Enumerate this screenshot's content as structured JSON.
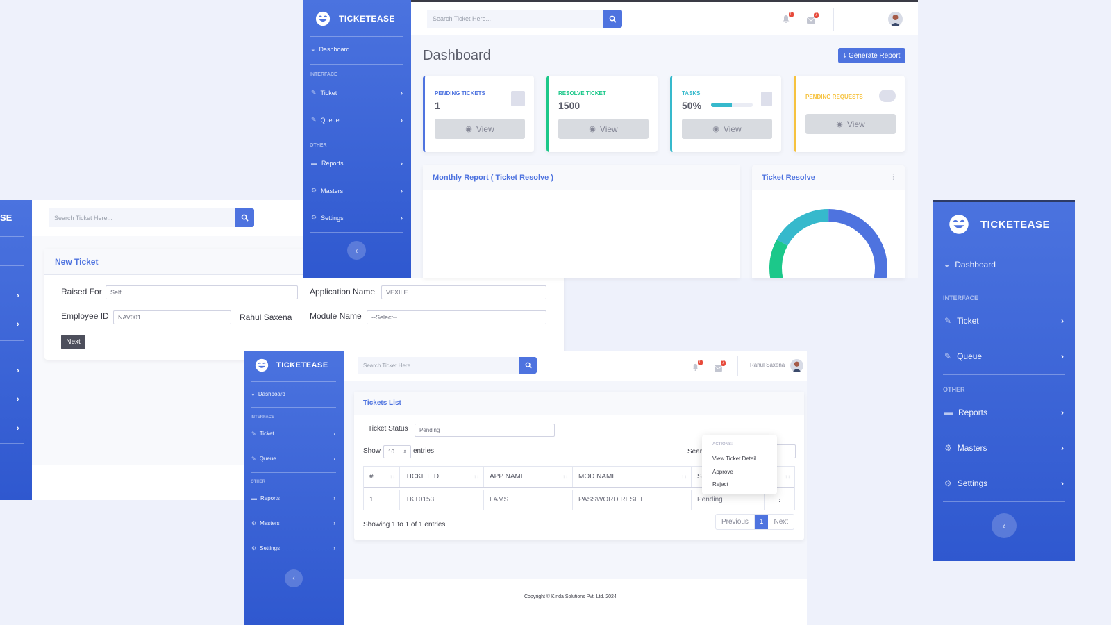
{
  "brand": "TICKETEASE",
  "search": {
    "placeholder": "Search Ticket Here..."
  },
  "user": {
    "name": "Rahul Saxena"
  },
  "sidebar": {
    "dashboard": "Dashboard",
    "interface_heading": "INTERFACE",
    "ticket": "Ticket",
    "queue": "Queue",
    "other_heading": "OTHER",
    "reports": "Reports",
    "masters": "Masters",
    "settings": "Settings"
  },
  "notifications": {
    "alerts_count": "0",
    "messages_count": "7"
  },
  "dashboard": {
    "title": "Dashboard",
    "generate_report": "Generate Report",
    "cards": [
      {
        "label": "PENDING TICKETS",
        "value": "1",
        "button": "View",
        "color": "#4e73df"
      },
      {
        "label": "RESOLVE TICKET",
        "value": "1500",
        "button": "View",
        "color": "#1cc88a"
      },
      {
        "label": "TASKS",
        "value": "50%",
        "progress": 0.5,
        "button": "View",
        "color": "#36b9cc"
      },
      {
        "label": "PENDING REQUESTS",
        "value": "",
        "button": "View",
        "color": "#f6c23e"
      }
    ],
    "monthly_report_title": "Monthly Report ( Ticket Resolve )",
    "ticket_resolve_title": "Ticket Resolve"
  },
  "donut": {
    "segments": [
      {
        "share": 0.5,
        "color": "#4e73df"
      },
      {
        "share": 0.33,
        "color": "#1cc88a"
      },
      {
        "share": 0.17,
        "color": "#36b9cc"
      }
    ]
  },
  "new_ticket": {
    "title": "New Ticket",
    "raised_for_label": "Raised For",
    "raised_for_value": "Self",
    "application_name_label": "Application Name",
    "application_name_value": "VEXILE",
    "employee_id_label": "Employee ID",
    "employee_id_value": "NAV001",
    "employee_name": "Rahul Saxena",
    "module_name_label": "Module Name",
    "module_name_value": "--Select--",
    "next_button": "Next"
  },
  "tickets_list": {
    "title": "Tickets List",
    "status_label": "Ticket Status",
    "status_value": "Pending",
    "show_label": "Show",
    "show_value": "10",
    "entries_label": "entries",
    "search_label": "Sear",
    "columns": [
      "#",
      "TICKET ID",
      "APP NAME",
      "MOD NAME",
      "S"
    ],
    "rows": [
      {
        "num": "1",
        "ticket_id": "TKT0153",
        "app": "LAMS",
        "mod": "PASSWORD RESET",
        "status": "Pending"
      }
    ],
    "showing": "Showing 1 to 1 of 1 entries",
    "pagination": {
      "previous": "Previous",
      "page": "1",
      "next": "Next"
    },
    "actions": {
      "heading": "ACTIONS:",
      "items": [
        "View Ticket Detail",
        "Approve",
        "Reject"
      ]
    }
  },
  "footer": {
    "copyright": "Copyright © Kinda Solutions Pvt. Ltd. 2024"
  },
  "left_partial": {
    "brand_fragment": "SE"
  }
}
